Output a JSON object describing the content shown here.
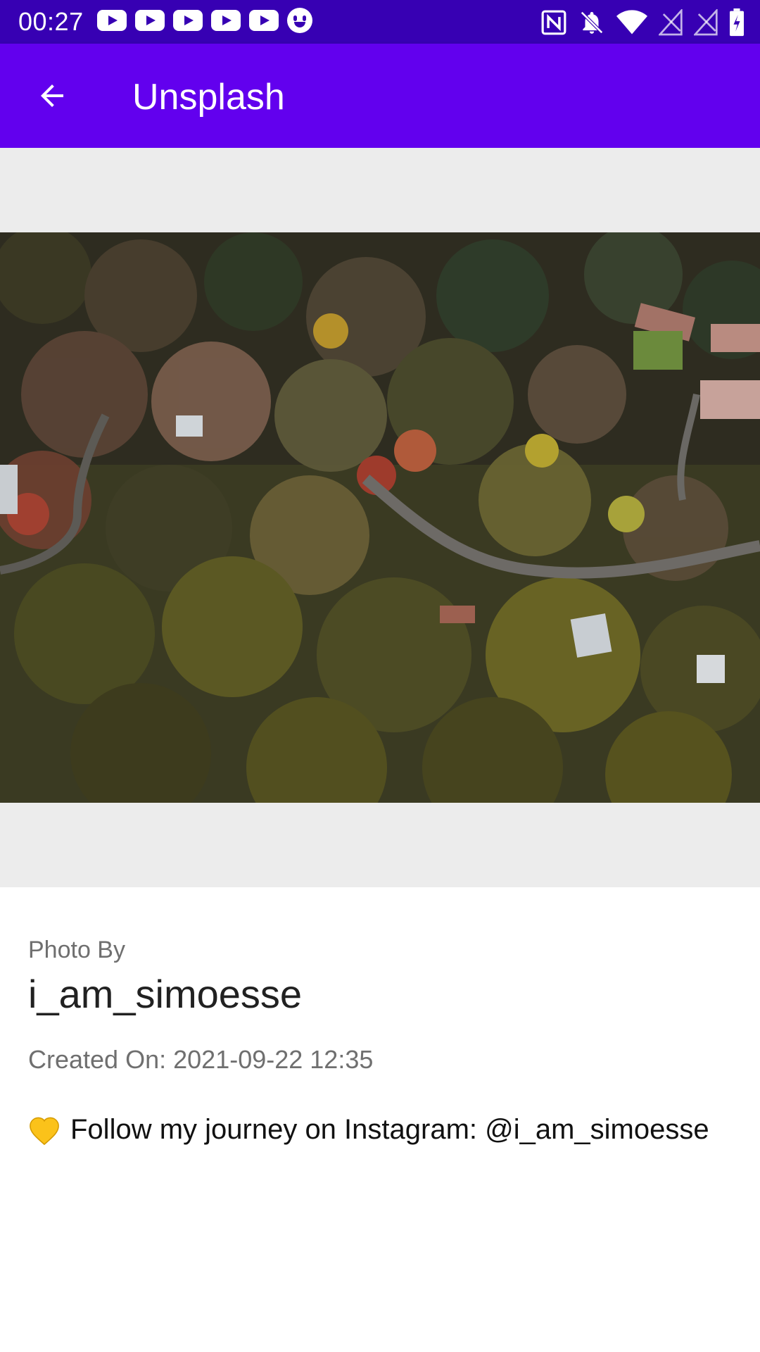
{
  "status_bar": {
    "time": "00:27",
    "notification_icons": [
      "youtube-icon",
      "youtube-icon",
      "youtube-icon",
      "youtube-icon",
      "youtube-icon",
      "face-icon"
    ],
    "system_icons": [
      "nfc-icon",
      "bell-off-icon",
      "wifi-icon",
      "signal-icon",
      "signal-icon",
      "battery-charging-icon"
    ]
  },
  "app_bar": {
    "title": "Unsplash",
    "back_icon": "arrow-back-icon",
    "color": "#6200ee"
  },
  "photo": {
    "description": "Aerial view of autumn forest with winding road and houses"
  },
  "details": {
    "photo_by_label": "Photo By",
    "author": "i_am_simoesse",
    "created_label": "Created On:",
    "created_value": "2021-09-22 12:35",
    "description_emoji": "💛",
    "description_text": "Follow my journey on Instagram: @i_am_simoesse"
  },
  "colors": {
    "status_bar": "#3700b3",
    "app_bar": "#6200ee",
    "photo_background": "#ececec"
  }
}
